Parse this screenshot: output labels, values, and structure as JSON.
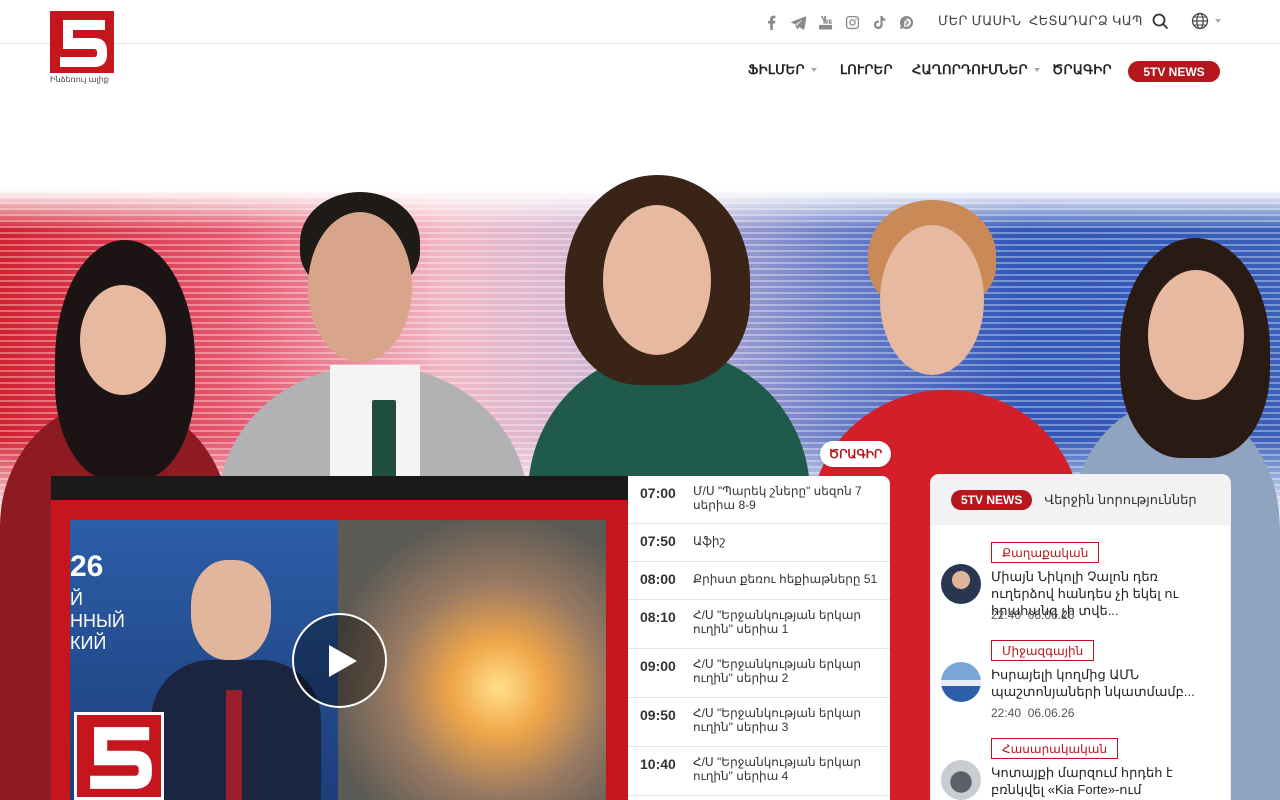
{
  "brand": {
    "logo_text": "5",
    "tagline": "Ինձեռույ ալիք"
  },
  "topbar": {
    "social_icons": [
      "facebook-icon",
      "telegram-icon",
      "youtube-icon",
      "instagram-icon",
      "tiktok-icon",
      "podcast-icon"
    ],
    "about_label": "ՄԵՐ ՄԱՍԻՆ",
    "feedback_label": "ՀԵՏԱԴԱՐՁ ԿԱՊ"
  },
  "nav": {
    "items": [
      {
        "label": "ՖԻԼՄԵՐ",
        "has_dropdown": true
      },
      {
        "label": "ԼՈՒՐԵՐ",
        "has_dropdown": false
      },
      {
        "label": "ՀԱՂՈՐԴՈՒՄՆԵՐ",
        "has_dropdown": true
      },
      {
        "label": "ԾՐԱԳԻՐ",
        "has_dropdown": false
      }
    ],
    "button_label": "5TV NEWS"
  },
  "video": {
    "overlay_number": "26",
    "overlay_text": "Й\nННЫЙ\nКИЙ"
  },
  "schedule": {
    "badge": "ԾՐԱԳԻՐ",
    "rows": [
      {
        "time": "07:00",
        "title": "Մ/Ս \"Պարեկ շները\" սեզոն 7 սերիա 8-9"
      },
      {
        "time": "07:50",
        "title": "Աֆիշ"
      },
      {
        "time": "08:00",
        "title": "Քրիստ քեռու հեքիաթները 51"
      },
      {
        "time": "08:10",
        "title": "Հ/Ս \"Երջանկության երկար ուղին\" սերիա 1"
      },
      {
        "time": "09:00",
        "title": "Հ/Ս \"Երջանկության երկար ուղին\" սերիա 2"
      },
      {
        "time": "09:50",
        "title": "Հ/Ս \"Երջանկության երկար ուղին\" սերիա 3"
      },
      {
        "time": "10:40",
        "title": "Հ/Ս \"Երջանկության երկար ուղին\" սերիա 4"
      }
    ]
  },
  "news": {
    "badge": "5TV NEWS",
    "subtitle": "Վերջին նորություններ",
    "items": [
      {
        "category": "Քաղաքական",
        "title": "Միայն Նիկոլի Չալոն դեռ ուղերձով հանդես չի եկել ու հրահանգ չի տվե...",
        "time": "22:40",
        "date": "06.06.26"
      },
      {
        "category": "Միջազգային",
        "title": "Իսրայելի կողմից ԱՄՆ պաշտոնյաների նկատմամբ...",
        "time": "22:40",
        "date": "06.06.26"
      },
      {
        "category": "Հասարակական",
        "title": "Կոտայքի մարզում հրդեհ է բռնկվել «Kia Forte»-ում",
        "time": "",
        "date": ""
      }
    ]
  },
  "colors": {
    "brand_red": "#b5171d",
    "text": "#222222"
  }
}
